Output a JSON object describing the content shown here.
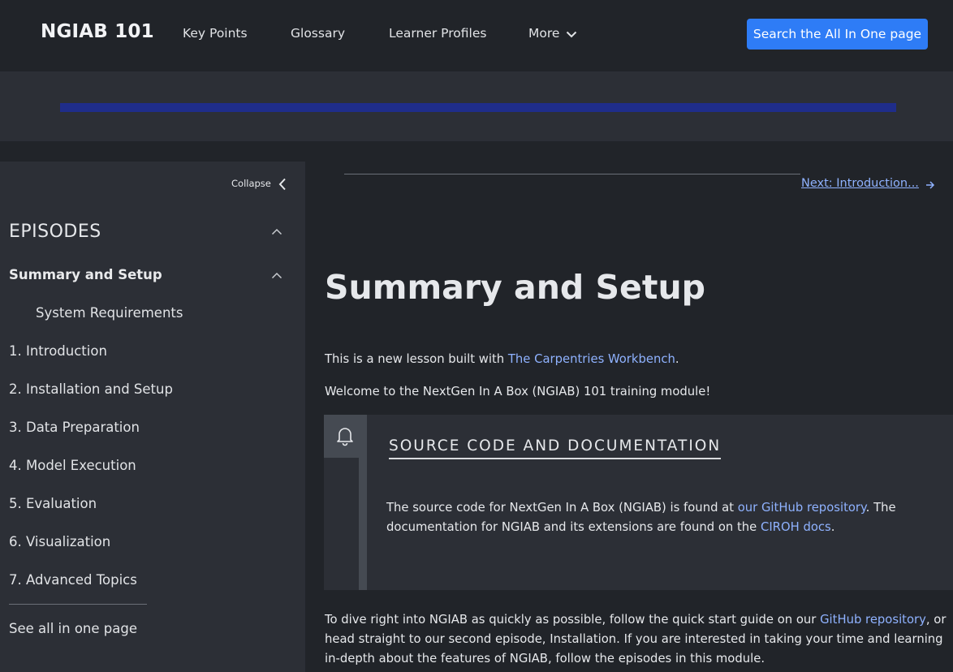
{
  "header": {
    "brand": "NGIAB 101",
    "nav": [
      "Key Points",
      "Glossary",
      "Learner Profiles",
      "More"
    ],
    "search_button": "Search the All In One page",
    "progress_percent": 100
  },
  "sidebar": {
    "collapse_label": "Collapse",
    "episodes_title": "EPISODES",
    "current": "Summary and Setup",
    "current_sub": "System Requirements",
    "items": [
      "1. Introduction",
      "2. Installation and Setup",
      "3. Data Preparation",
      "4. Model Execution",
      "5. Evaluation",
      "6. Visualization",
      "7. Advanced Topics"
    ],
    "see_all": "See all in one page"
  },
  "main": {
    "next_link": "Next: Introduction...",
    "title": "Summary and Setup",
    "intro_before": "This is a new lesson built with ",
    "intro_link": "The Carpentries Workbench",
    "intro_after": ".",
    "welcome": "Welcome to the NextGen In A Box (NGIAB) 101 training module!",
    "callout": {
      "heading": "SOURCE CODE AND DOCUMENTATION",
      "text_1": "The source code for NextGen In A Box (NGIAB) is found at ",
      "link_1": "our GitHub repository",
      "text_2": ". The documentation for NGIAB and its extensions are found on the ",
      "link_2": "CIROH docs",
      "text_3": "."
    },
    "dive_1": "To dive right into NGIAB as quickly as possible, follow the quick start guide on our ",
    "dive_link": "GitHub repository",
    "dive_2": ", or head straight to our second episode, Installation. If you are interested in taking your time and learning in-depth about the features of NGIAB, follow the episodes in this module."
  },
  "icons": {
    "more": "chevron-down-icon",
    "collapse": "chevron-left-icon",
    "episodes_toggle": "chevron-up-icon",
    "next": "arrow-right-icon",
    "callout": "bell-icon"
  },
  "colors": {
    "accent": "#2e7cf6",
    "link": "#8fb2ff",
    "background": "#212429",
    "panel": "#2c2f36",
    "progress": "#1f2d8a"
  }
}
